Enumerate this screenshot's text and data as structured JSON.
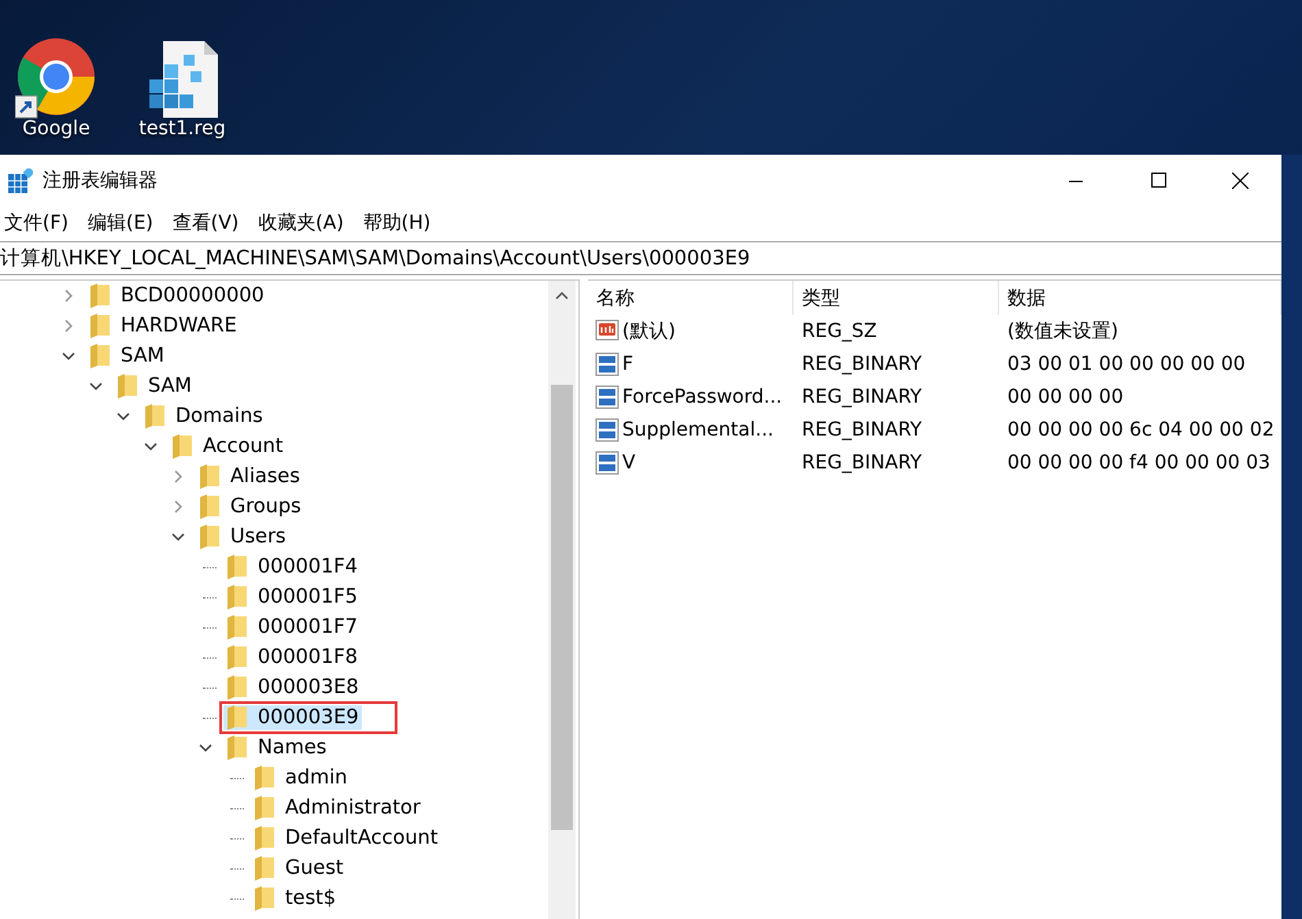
{
  "desktop": {
    "icons": [
      {
        "label": "Google",
        "kind": "browser"
      },
      {
        "label": "test1.reg",
        "kind": "regfile"
      }
    ]
  },
  "window": {
    "title": "注册表编辑器"
  },
  "menu": [
    "文件(F)",
    "编辑(E)",
    "查看(V)",
    "收藏夹(A)",
    "帮助(H)"
  ],
  "address": "计算机\\HKEY_LOCAL_MACHINE\\SAM\\SAM\\Domains\\Account\\Users\\000003E9",
  "tree": [
    {
      "label": "BCD00000000",
      "kind": "branch",
      "expanded": false,
      "selected": false,
      "marked": false
    },
    {
      "label": "HARDWARE",
      "kind": "branch",
      "expanded": false,
      "selected": false,
      "marked": false
    },
    {
      "label": "SAM",
      "kind": "branch",
      "expanded": true,
      "selected": false,
      "marked": false,
      "children": [
        {
          "label": "SAM",
          "kind": "branch",
          "expanded": true,
          "selected": false,
          "marked": false,
          "children": [
            {
              "label": "Domains",
              "kind": "branch",
              "expanded": true,
              "selected": false,
              "marked": false,
              "children": [
                {
                  "label": "Account",
                  "kind": "branch",
                  "expanded": true,
                  "selected": false,
                  "marked": false,
                  "children": [
                    {
                      "label": "Aliases",
                      "kind": "branch",
                      "expanded": false,
                      "selected": false,
                      "marked": false
                    },
                    {
                      "label": "Groups",
                      "kind": "branch",
                      "expanded": false,
                      "selected": false,
                      "marked": false
                    },
                    {
                      "label": "Users",
                      "kind": "branch",
                      "expanded": true,
                      "selected": false,
                      "marked": false,
                      "children": [
                        {
                          "label": "000001F4",
                          "kind": "leaf",
                          "selected": false,
                          "marked": false
                        },
                        {
                          "label": "000001F5",
                          "kind": "leaf",
                          "selected": false,
                          "marked": false
                        },
                        {
                          "label": "000001F7",
                          "kind": "leaf",
                          "selected": false,
                          "marked": false
                        },
                        {
                          "label": "000001F8",
                          "kind": "leaf",
                          "selected": false,
                          "marked": false
                        },
                        {
                          "label": "000003E8",
                          "kind": "leaf",
                          "selected": false,
                          "marked": false
                        },
                        {
                          "label": "000003E9",
                          "kind": "leaf",
                          "selected": true,
                          "marked": true
                        },
                        {
                          "label": "Names",
                          "kind": "branch",
                          "expanded": true,
                          "selected": false,
                          "marked": false,
                          "children": [
                            {
                              "label": "admin",
                              "kind": "leaf",
                              "selected": false,
                              "marked": false
                            },
                            {
                              "label": "Administrator",
                              "kind": "leaf",
                              "selected": false,
                              "marked": false
                            },
                            {
                              "label": "DefaultAccount",
                              "kind": "leaf",
                              "selected": false,
                              "marked": false
                            },
                            {
                              "label": "Guest",
                              "kind": "leaf",
                              "selected": false,
                              "marked": false
                            },
                            {
                              "label": "test$",
                              "kind": "leaf",
                              "selected": false,
                              "marked": false
                            }
                          ]
                        }
                      ]
                    }
                  ]
                }
              ]
            }
          ]
        }
      ]
    }
  ],
  "table": {
    "columns": [
      "名称",
      "类型",
      "数据"
    ],
    "rows": [
      {
        "kind": "string",
        "name": "(默认)",
        "type": "REG_SZ",
        "data": "(数值未设置)"
      },
      {
        "kind": "binary",
        "name": "F",
        "type": "REG_BINARY",
        "data": "03 00 01 00 00 00 00 00"
      },
      {
        "kind": "binary",
        "name": "ForcePassword...",
        "type": "REG_BINARY",
        "data": "00 00 00 00"
      },
      {
        "kind": "binary",
        "name": "Supplemental...",
        "type": "REG_BINARY",
        "data": "00 00 00 00 6c 04 00 00 02"
      },
      {
        "kind": "binary",
        "name": "V",
        "type": "REG_BINARY",
        "data": "00 00 00 00 f4 00 00 00 03"
      }
    ]
  }
}
